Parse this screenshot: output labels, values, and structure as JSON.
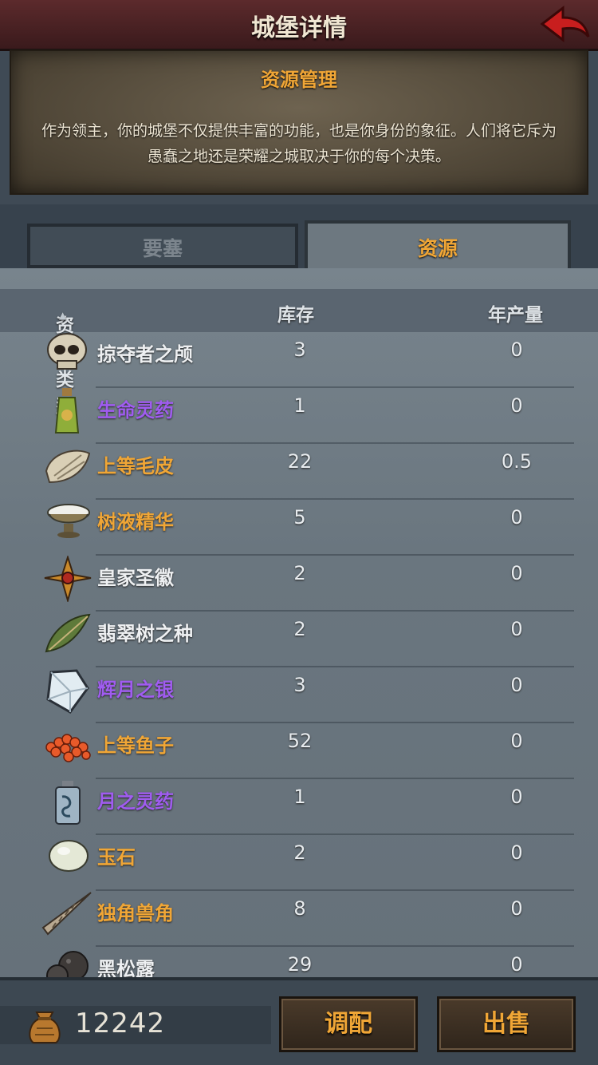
{
  "header": {
    "title": "城堡详情"
  },
  "intro": {
    "title": "资源管理",
    "text": "作为领主，你的城堡不仅提供丰富的功能，也是你身份的象征。人们将它斥为愚蠢之地还是荣耀之城取决于你的每个决策。"
  },
  "tabs": [
    {
      "label": "要塞",
      "active": false
    },
    {
      "label": "资源",
      "active": true
    }
  ],
  "table": {
    "headers": {
      "type": "资源类型",
      "stock": "库存",
      "yield": "年产量"
    },
    "rows": [
      {
        "name": "掠夺者之颅",
        "stock": "3",
        "yield": "0",
        "name_color": "white",
        "icon": "skull-icon"
      },
      {
        "name": "生命灵药",
        "stock": "1",
        "yield": "0",
        "name_color": "purple",
        "icon": "potion-bottle-icon"
      },
      {
        "name": "上等毛皮",
        "stock": "22",
        "yield": "0.5",
        "name_color": "orange",
        "icon": "fur-pelt-icon"
      },
      {
        "name": "树液精华",
        "stock": "5",
        "yield": "0",
        "name_color": "orange",
        "icon": "sap-bowl-icon"
      },
      {
        "name": "皇家圣徽",
        "stock": "2",
        "yield": "0",
        "name_color": "white",
        "icon": "royal-emblem-icon"
      },
      {
        "name": "翡翠树之种",
        "stock": "2",
        "yield": "0",
        "name_color": "white",
        "icon": "emerald-seed-icon"
      },
      {
        "name": "辉月之银",
        "stock": "3",
        "yield": "0",
        "name_color": "purple",
        "icon": "moon-silver-icon"
      },
      {
        "name": "上等鱼子",
        "stock": "52",
        "yield": "0",
        "name_color": "orange",
        "icon": "fish-roe-icon"
      },
      {
        "name": "月之灵药",
        "stock": "1",
        "yield": "0",
        "name_color": "purple",
        "icon": "moon-elixir-icon"
      },
      {
        "name": "玉石",
        "stock": "2",
        "yield": "0",
        "name_color": "orange",
        "icon": "jade-stone-icon"
      },
      {
        "name": "独角兽角",
        "stock": "8",
        "yield": "0",
        "name_color": "orange",
        "icon": "unicorn-horn-icon"
      },
      {
        "name": "黑松露",
        "stock": "29",
        "yield": "0",
        "name_color": "white",
        "icon": "black-truffle-icon"
      }
    ]
  },
  "footer": {
    "gold": "12242",
    "allocate_label": "调配",
    "sell_label": "出售"
  },
  "colors": {
    "accent_orange": "#f0a636",
    "rare_purple": "#a05cf0",
    "header_red": "#5c2a2c"
  }
}
